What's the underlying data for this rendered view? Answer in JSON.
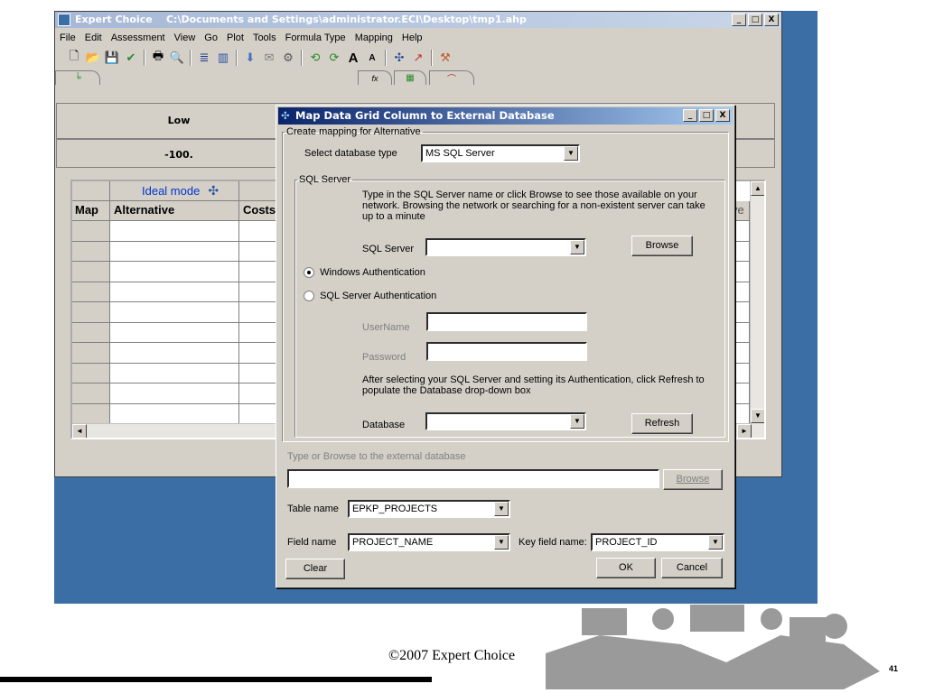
{
  "window": {
    "title": "Expert Choice    C:\\Documents and Settings\\administrator.ECI\\Desktop\\tmp1.ahp",
    "controls": [
      "_",
      "□",
      "X"
    ]
  },
  "menu": [
    "File",
    "Edit",
    "Assessment",
    "View",
    "Go",
    "Plot",
    "Tools",
    "Formula Type",
    "Mapping",
    "Help"
  ],
  "toolbar_icons": [
    "new-icon",
    "open-icon",
    "save-icon",
    "check-icon",
    "print-icon",
    "preview-icon",
    "bars-icon",
    "chart-icon",
    "down-arrow-icon",
    "doc-icon",
    "cycle-icon",
    "refresh-icon",
    "green-refresh-icon",
    "font-up-icon",
    "font-down-icon",
    "network-icon",
    "graph-icon",
    "tool-icon"
  ],
  "grid_header": {
    "low_label": "Low",
    "low_value": "-100."
  },
  "grid": {
    "mode_label": "Ideal mode",
    "col_map": "Map",
    "col_alternative": "Alternative",
    "col_costs": "Costs",
    "col_right_partial": "ye"
  },
  "dialog": {
    "title": "Map Data Grid Column to External Database",
    "group_label": "Create mapping for Alternative",
    "db_type_label": "Select database type",
    "db_type_value": "MS SQL Server",
    "sql_group_label": "SQL Server",
    "sql_help": "Type in the SQL Server name or click Browse to see those available on your network.  Browsing the network or searching for a non-existent server can take up to a minute",
    "sql_server_label": "SQL Server",
    "sql_server_value": "",
    "browse_label": "Browse",
    "win_auth_label": "Windows Authentication",
    "sql_auth_label": "SQL Server Authentication",
    "username_label": "UserName",
    "password_label": "Password",
    "refresh_help": "After selecting your SQL Server and setting its Authentication, click Refresh to populate the Database drop-down box",
    "database_label": "Database",
    "refresh_label": "Refresh",
    "external_label": "Type or Browse to the external database",
    "browse2_label": "Browse",
    "table_label": "Table name",
    "table_value": "EPKP_PROJECTS",
    "field_label": "Field name",
    "field_value": "PROJECT_NAME",
    "key_label": "Key field name:",
    "key_value": "PROJECT_ID",
    "clear_label": "Clear",
    "ok_label": "OK",
    "cancel_label": "Cancel"
  },
  "slide": {
    "footer": "©2007 Expert Choice",
    "page": "41"
  }
}
